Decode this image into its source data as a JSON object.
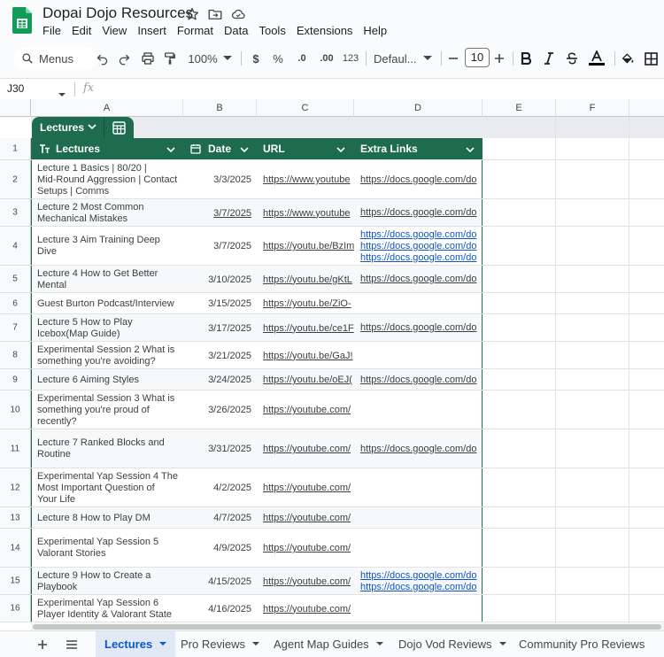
{
  "app": {
    "title": "Dopai Dojo Resources",
    "menu": [
      "File",
      "Edit",
      "View",
      "Insert",
      "Format",
      "Data",
      "Tools",
      "Extensions",
      "Help"
    ]
  },
  "toolbar": {
    "search_label": "Menus",
    "zoom": "100%",
    "currency": "$",
    "percent": "%",
    "dec_decrease": ".0",
    "dec_increase": ".00",
    "number_format": "123",
    "font": "Defaul...",
    "font_size": "10"
  },
  "formula_bar": {
    "cell_ref": "J30",
    "fx": "fx",
    "value": ""
  },
  "columns": [
    "A",
    "B",
    "C",
    "D",
    "E",
    "F"
  ],
  "table": {
    "name": "Lectures",
    "headers": [
      "Lectures",
      "Date",
      "URL",
      "Extra Links"
    ],
    "rows": [
      {
        "row": "1"
      },
      {
        "row": "2",
        "lecture": [
          "Lecture 1 Basics | 80/20 |",
          "Mid-Round Aggression | Contact",
          "Setups | Comms"
        ],
        "date": "3/3/2025",
        "url": "https://www.youtube",
        "extra": [
          "https://docs.google.com/do"
        ]
      },
      {
        "row": "3",
        "lecture": [
          "Lecture 2 Most Common",
          "Mechanical Mistakes"
        ],
        "date": "3/7/2025",
        "url": "https://www.youtube",
        "extra": [
          "https://docs.google.com/do"
        ]
      },
      {
        "row": "4",
        "lecture": [
          "Lecture 3 Aim Training Deep",
          "Dive"
        ],
        "date": "3/7/2025",
        "url": "https://youtu.be/BzIm",
        "extra": [
          "https://docs.google.com/do",
          "https://docs.google.com/do",
          "https://docs.google.com/do"
        ]
      },
      {
        "row": "5",
        "lecture": [
          "Lecture 4 How to Get Better",
          "Mental"
        ],
        "date": "3/10/2025",
        "url": "https://youtu.be/gKtL",
        "extra": [
          "https://docs.google.com/do"
        ]
      },
      {
        "row": "6",
        "lecture": [
          "Guest Burton Podcast/Interview"
        ],
        "date": "3/15/2025",
        "url": "https://youtu.be/ZiO-",
        "extra": []
      },
      {
        "row": "7",
        "lecture": [
          "Lecture 5 How to Play",
          "Icebox(Map Guide)"
        ],
        "date": "3/17/2025",
        "url": "https://youtu.be/ce1F",
        "extra": [
          "https://docs.google.com/do"
        ]
      },
      {
        "row": "8",
        "lecture": [
          "Experimental Session 2 What is",
          "something you're avoiding?"
        ],
        "date": "3/21/2025",
        "url": "https://youtu.be/GaJ!",
        "extra": []
      },
      {
        "row": "9",
        "lecture": [
          "Lecture 6 Aiming Styles"
        ],
        "date": "3/24/2025",
        "url": "https://youtu.be/oEJ(",
        "extra": [
          "https://docs.google.com/do"
        ]
      },
      {
        "row": "10",
        "lecture": [
          "Experimental Session 3 What is",
          "something you're proud of",
          "recently?"
        ],
        "date": "3/26/2025",
        "url": "https://youtube.com/",
        "extra": []
      },
      {
        "row": "11",
        "lecture": [
          "Lecture 7 Ranked Blocks and",
          "Routine"
        ],
        "date": "3/31/2025",
        "url": "https://youtube.com/",
        "extra": [
          "https://docs.google.com/do"
        ]
      },
      {
        "row": "12",
        "lecture": [
          "Experimental Yap Session 4 The",
          "Most Important Question of",
          "Your Life"
        ],
        "date": "4/2/2025",
        "url": "https://youtube.com/",
        "extra": []
      },
      {
        "row": "13",
        "lecture": [
          "Lecture 8 How to Play DM"
        ],
        "date": "4/7/2025",
        "url": "https://youtube.com/",
        "extra": []
      },
      {
        "row": "14",
        "lecture": [
          "Experimental Yap Session 5",
          "Valorant Stories"
        ],
        "date": "4/9/2025",
        "url": "https://youtube.com/",
        "extra": []
      },
      {
        "row": "15",
        "lecture": [
          "Lecture 9 How to Create a",
          "Playbook"
        ],
        "date": "4/15/2025",
        "url": "https://youtube.com/",
        "extra": [
          "https://docs.google.com/do",
          "https://docs.google.com/do"
        ]
      },
      {
        "row": "16",
        "lecture": [
          "Experimental Yap Session 6",
          "Player Identity & Valorant State"
        ],
        "date": "4/16/2025",
        "url": "https://youtube.com/",
        "extra": []
      }
    ]
  },
  "sheet_tabs": [
    "Lectures",
    "Pro Reviews",
    "Agent Map Guides",
    "Dojo Vod Reviews",
    "Community Pro Reviews"
  ],
  "active_tab": "Lectures",
  "colors": {
    "table_header": "#1e6b4f",
    "link_blue": "#1155cc",
    "active_tab_bg": "#e1e9f7",
    "active_tab_text": "#0b57d0",
    "sheets_green": "#0f9d58"
  }
}
